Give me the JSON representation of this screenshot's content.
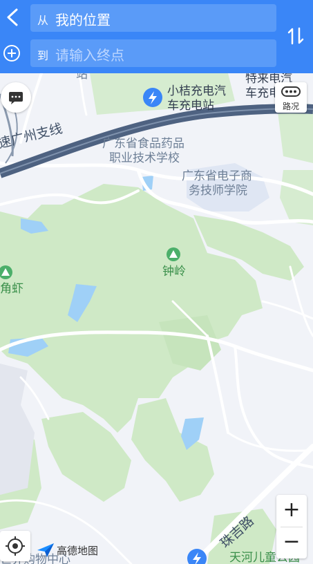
{
  "route": {
    "from_prefix": "从",
    "from_value": "我的位置",
    "to_prefix": "到",
    "to_placeholder": "请输入终点"
  },
  "map": {
    "labels": {
      "charger_top": "小桔充电汽车充电站",
      "charger_top_line1": "小桔充电汽",
      "charger_top_line2": "车充电站",
      "charger_right_line1": "特来电汽",
      "charger_right_line2": "车充电",
      "partial_top": "站",
      "highway": "速广州支线",
      "school1_line1": "广东省食品药品",
      "school1_line2": "职业技术学校",
      "school2_line1": "广东省电子商",
      "school2_line2": "务技师学院",
      "hill": "钟岭",
      "shrimp": "角虾",
      "road_zhuji": "珠吉路",
      "park": "天河儿童公园",
      "bottom_left": "世界购物中心"
    },
    "traffic_label": "路况",
    "logo_text": "高德地图",
    "zoom_in": "+",
    "zoom_out": "−"
  },
  "colors": {
    "accent": "#3a86f7",
    "green": "#cfe9c6",
    "water": "#9fd0f7",
    "road": "#ffffff",
    "highway": "#4e6281"
  }
}
